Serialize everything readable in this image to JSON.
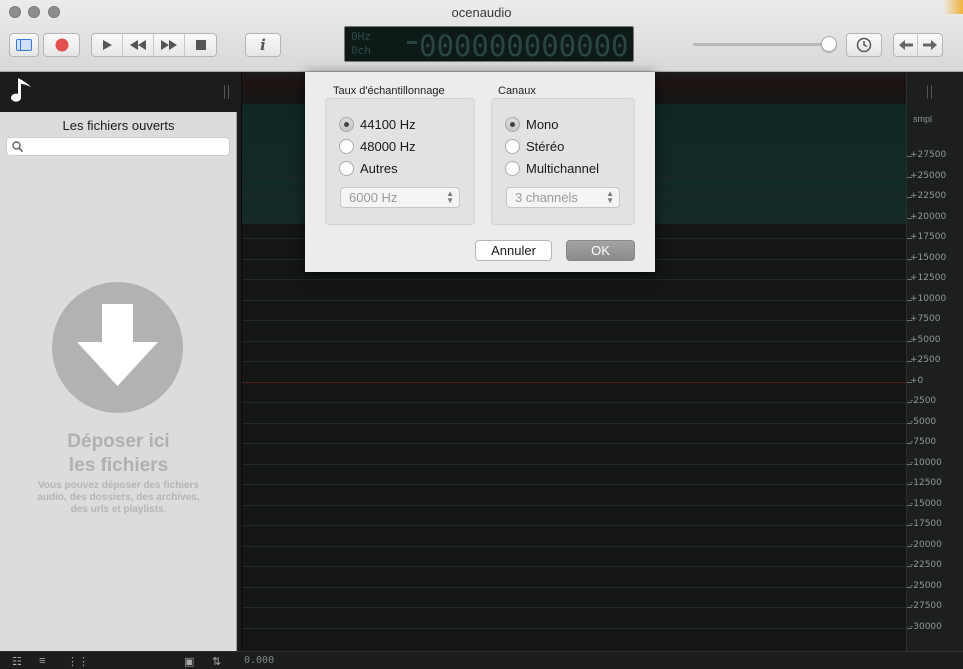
{
  "window": {
    "title": "ocenaudio"
  },
  "toolbar": {
    "lcd": {
      "rate": "0Hz",
      "channels": "0ch",
      "digits": "000000000000"
    }
  },
  "sidebar": {
    "title": "Les fichiers ouverts",
    "search_placeholder": "",
    "drop_title_line1": "Déposer ici",
    "drop_title_line2": "les fichiers",
    "drop_subtitle": "Vous pouvez déposer des fichiers audio, des dossiers, des archives, des urls et playlists."
  },
  "ruler": {
    "unit": "smpl",
    "labels": [
      "+27500",
      "+25000",
      "+22500",
      "+20000",
      "+17500",
      "+15000",
      "+12500",
      "+10000",
      "+7500",
      "+5000",
      "+2500",
      "+0",
      "-2500",
      "-5000",
      "-7500",
      "-10000",
      "-12500",
      "-15000",
      "-17500",
      "-20000",
      "-22500",
      "-25000",
      "-27500",
      "-30000"
    ]
  },
  "bottom": {
    "time": "0.000"
  },
  "dialog": {
    "sample_rate": {
      "title": "Taux d'échantillonnage",
      "options": [
        "44100 Hz",
        "48000 Hz",
        "Autres"
      ],
      "selected": "44100 Hz",
      "custom_value": "6000 Hz"
    },
    "channels": {
      "title": "Canaux",
      "options": [
        "Mono",
        "Stéréo",
        "Multichannel"
      ],
      "selected": "Mono",
      "custom_value": "3 channels"
    },
    "cancel_label": "Annuler",
    "ok_label": "OK"
  },
  "colors": {
    "accent_record": "#e35050",
    "zero_line": "#5b1c20",
    "waveform_bg": "#142a28"
  }
}
